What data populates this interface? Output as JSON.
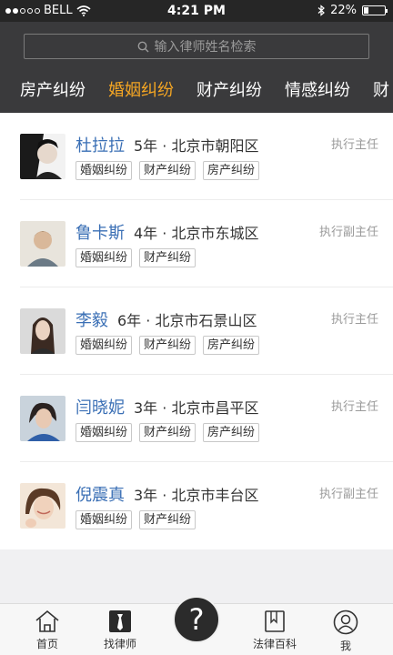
{
  "status_bar": {
    "carrier": "BELL",
    "time": "4:21 PM",
    "battery_pct_label": "22%",
    "battery_level": 0.22
  },
  "search": {
    "placeholder": "输入律师姓名检索"
  },
  "tabs": [
    {
      "label": "房产纠纷",
      "active": false
    },
    {
      "label": "婚姻纠纷",
      "active": true
    },
    {
      "label": "财产纠纷",
      "active": false
    },
    {
      "label": "情感纠纷",
      "active": false
    },
    {
      "label": "财",
      "active": false
    }
  ],
  "lawyers": [
    {
      "name": "杜拉拉",
      "meta": "5年 · 北京市朝阳区",
      "title": "执行主任",
      "tags": [
        "婚姻纠纷",
        "财产纠纷",
        "房产纠纷"
      ]
    },
    {
      "name": "鲁卡斯",
      "meta": "4年 · 北京市东城区",
      "title": "执行副主任",
      "tags": [
        "婚姻纠纷",
        "财产纠纷"
      ]
    },
    {
      "name": "李毅",
      "meta": "6年 · 北京市石景山区",
      "title": "执行主任",
      "tags": [
        "婚姻纠纷",
        "财产纠纷",
        "房产纠纷"
      ]
    },
    {
      "name": "闫晓妮",
      "meta": "3年 · 北京市昌平区",
      "title": "执行主任",
      "tags": [
        "婚姻纠纷",
        "财产纠纷",
        "房产纠纷"
      ]
    },
    {
      "name": "倪震真",
      "meta": "3年 · 北京市丰台区",
      "title": "执行副主任",
      "tags": [
        "婚姻纠纷",
        "财产纠纷"
      ]
    }
  ],
  "bottom_nav": {
    "home": "首页",
    "find_lawyer": "找律师",
    "center_symbol": "?",
    "encyclopedia": "法律百科",
    "me": "我"
  },
  "colors": {
    "accent": "#f5a623",
    "name_link": "#3a6fb5",
    "header_bg": "#3a3a3c"
  }
}
